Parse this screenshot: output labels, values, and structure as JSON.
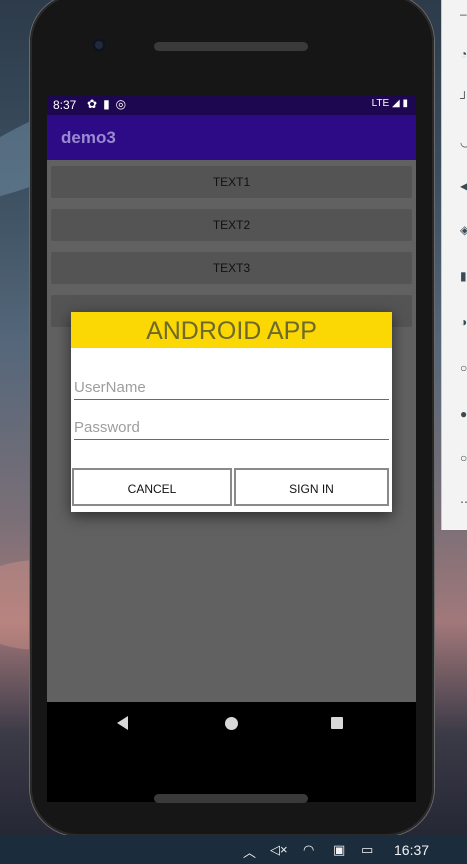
{
  "status_bar": {
    "time": "8:37",
    "network": "LTE"
  },
  "app": {
    "title": "demo3"
  },
  "buttons": [
    "TEXT1",
    "TEXT2",
    "TEXT3"
  ],
  "dialog": {
    "title": "ANDROID APP",
    "username_placeholder": "UserName",
    "password_placeholder": "Password",
    "cancel_label": "CANCEL",
    "signin_label": "SIGN IN",
    "header_color": "#fbd703"
  },
  "taskbar": {
    "time": "16:37"
  }
}
